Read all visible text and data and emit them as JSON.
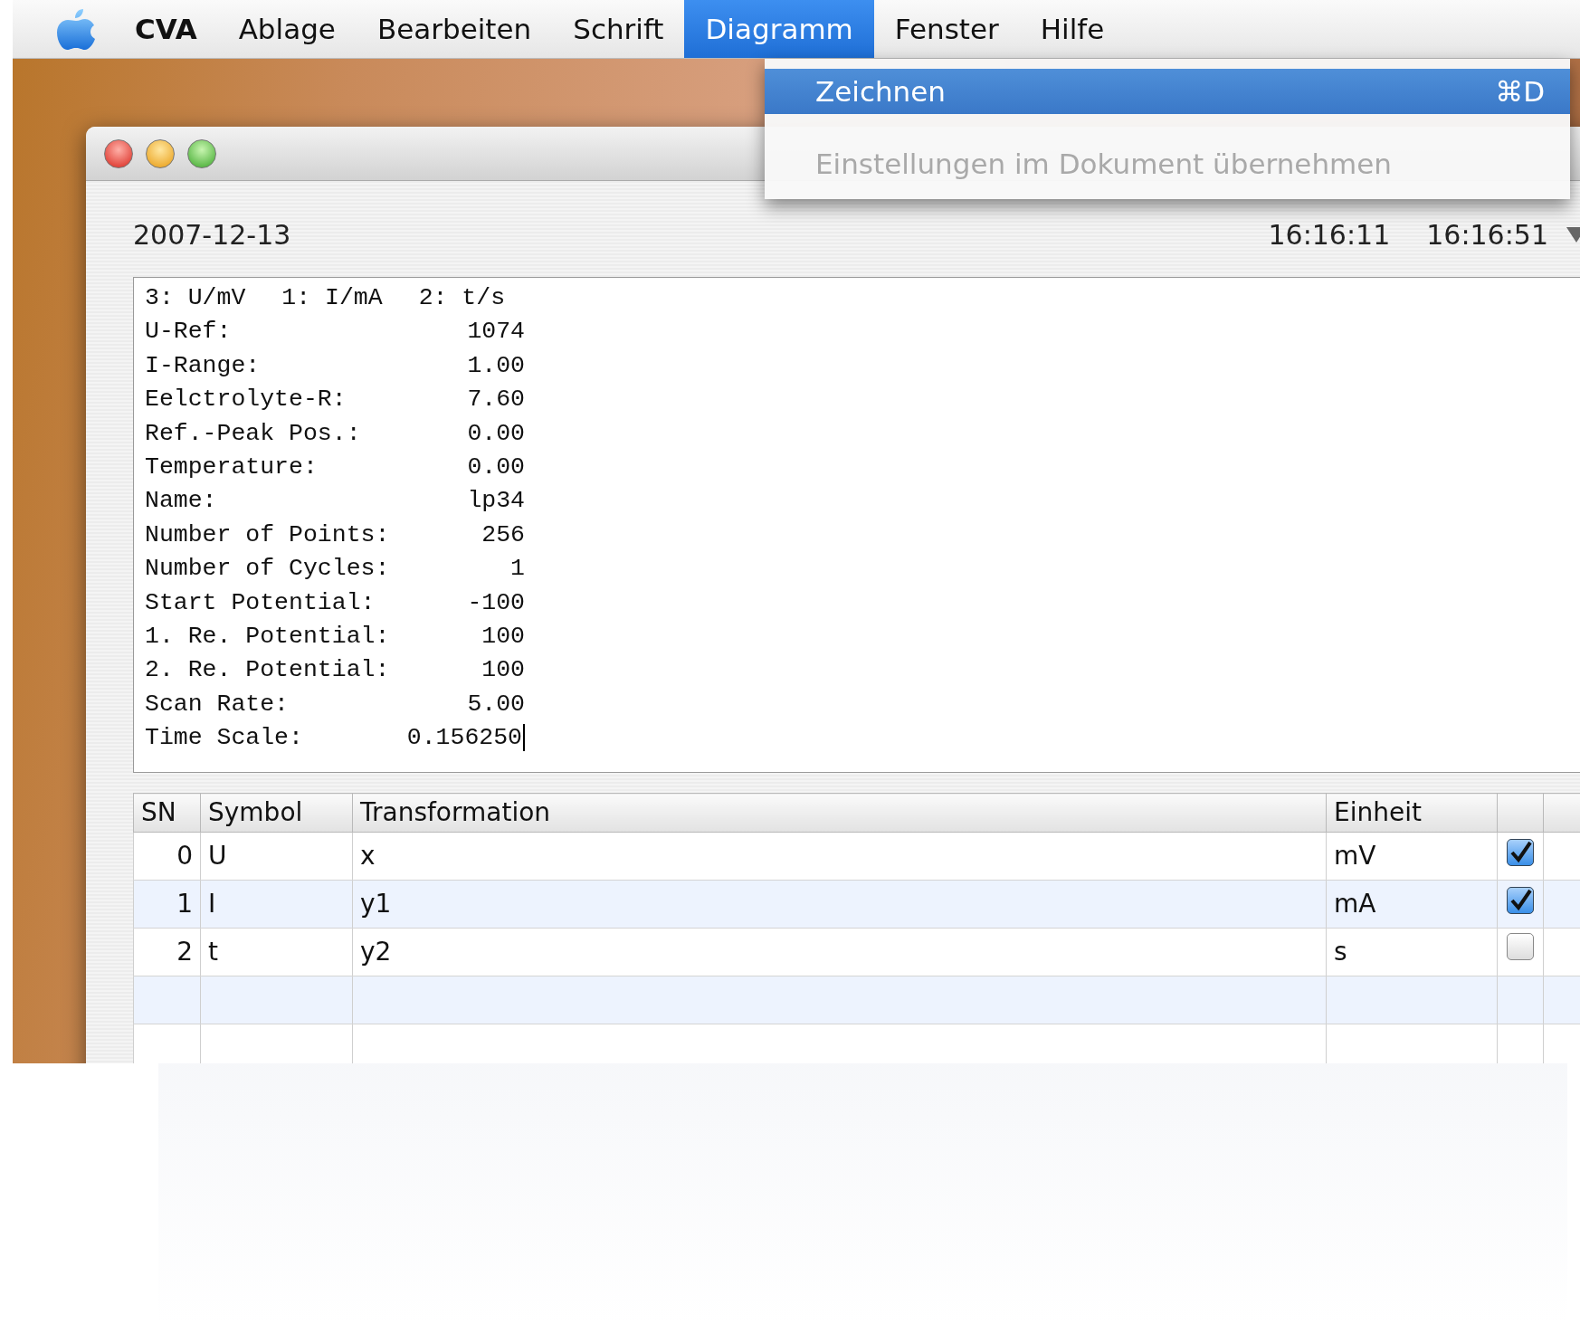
{
  "menu_bar": {
    "items": [
      {
        "label": "CVA",
        "selected": false,
        "bold": true
      },
      {
        "label": "Ablage",
        "selected": false,
        "bold": false
      },
      {
        "label": "Bearbeiten",
        "selected": false,
        "bold": false
      },
      {
        "label": "Schrift",
        "selected": false,
        "bold": false
      },
      {
        "label": "Diagramm",
        "selected": true,
        "bold": false
      },
      {
        "label": "Fenster",
        "selected": false,
        "bold": false
      },
      {
        "label": "Hilfe",
        "selected": false,
        "bold": false
      }
    ]
  },
  "dropdown_menu": {
    "items": [
      {
        "label": "Zeichnen",
        "shortcut": "⌘D",
        "selected": true,
        "disabled": false
      },
      {
        "label": "Einstellungen im Dokument übernehmen",
        "selected": false,
        "disabled": true
      }
    ]
  },
  "window": {
    "date": "2007-12-13",
    "start_time": "16:16:11",
    "end_time": "16:16:51",
    "text_area": {
      "header": [
        "3: U/mV",
        "1: I/mA",
        "2: t/s"
      ],
      "lines": [
        {
          "label": "U-Ref:",
          "value": "1074"
        },
        {
          "label": "I-Range:",
          "value": "1.00"
        },
        {
          "label": "Eelctrolyte-R:",
          "value": "7.60"
        },
        {
          "label": "Ref.-Peak Pos.:",
          "value": "0.00"
        },
        {
          "label": "Temperature:",
          "value": "0.00"
        },
        {
          "label": "Name:",
          "value": "lp34"
        },
        {
          "label": "Number of Points:",
          "value": "256"
        },
        {
          "label": "Number of Cycles:",
          "value": "1"
        },
        {
          "label": "Start Potential:",
          "value": "-100"
        },
        {
          "label": "1. Re. Potential:",
          "value": "100"
        },
        {
          "label": "2. Re. Potential:",
          "value": "100"
        },
        {
          "label": "Scan Rate:",
          "value": "5.00"
        },
        {
          "label": "Time Scale:",
          "value": "0.156250"
        }
      ]
    },
    "table": {
      "columns": [
        "SN",
        "Symbol",
        "Transformation",
        "Einheit"
      ],
      "rows": [
        {
          "sn": "0",
          "symbol": "U",
          "transformation": "x",
          "unit": "mV",
          "checked": true
        },
        {
          "sn": "1",
          "symbol": "I",
          "transformation": "y1",
          "unit": "mA",
          "checked": true
        },
        {
          "sn": "2",
          "symbol": "t",
          "transformation": "y2",
          "unit": "s",
          "checked": false
        }
      ]
    }
  }
}
